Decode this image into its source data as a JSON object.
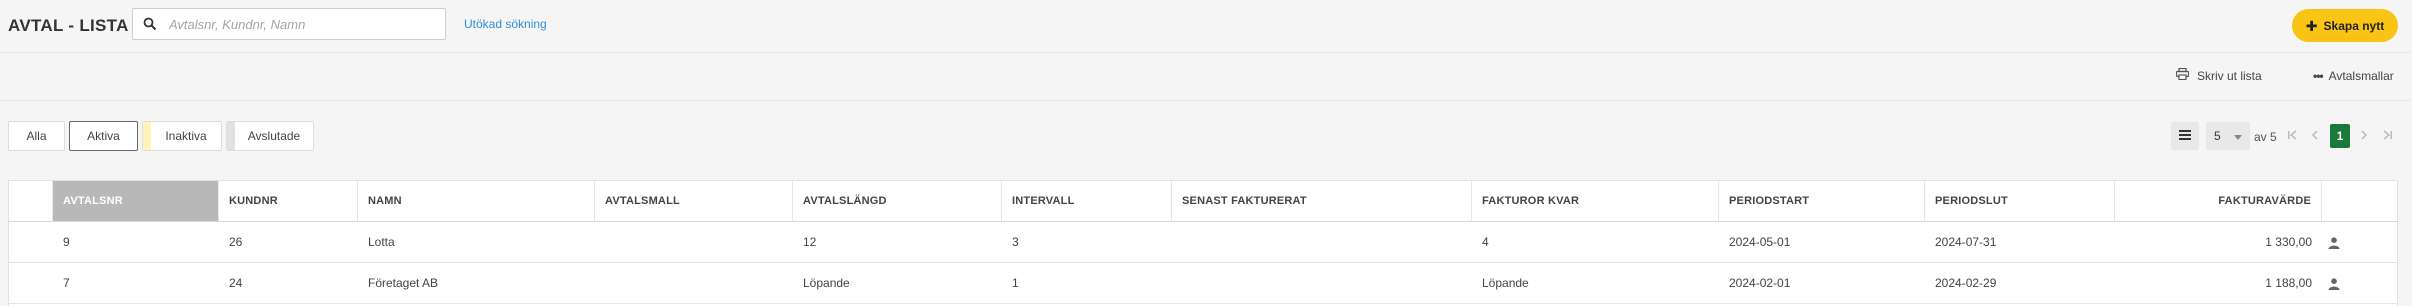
{
  "header": {
    "title": "AVTAL - LISTA",
    "search_placeholder": "Avtalsnr, Kundnr, Namn",
    "advanced_search": "Utökad sökning",
    "create_label": "Skapa nytt"
  },
  "toolbar": {
    "print_label": "Skriv ut lista",
    "templates_label": "Avtalsmallar"
  },
  "filters": [
    {
      "label": "Alla",
      "active": false,
      "color": ""
    },
    {
      "label": "Aktiva",
      "active": true,
      "color": ""
    },
    {
      "label": "Inaktiva",
      "active": false,
      "color": "#fff3b8"
    },
    {
      "label": "Avslutade",
      "active": false,
      "color": "#e2e2e2"
    }
  ],
  "pagination": {
    "page_size": "5",
    "of_label": "av 5",
    "current_page": "1"
  },
  "table": {
    "columns": [
      "AVTALSNR",
      "KUNDNR",
      "NAMN",
      "AVTALSMALL",
      "AVTALSLÄNGD",
      "INTERVALL",
      "SENAST FAKTURERAT",
      "FAKTUROR KVAR",
      "PERIODSTART",
      "PERIODSLUT",
      "FAKTURAVÄRDE"
    ],
    "sorted_column": "AVTALSNR",
    "rows": [
      [
        "9",
        "26",
        "Lotta",
        "",
        "12",
        "3",
        "",
        "4",
        "2024-05-01",
        "2024-07-31",
        "1 330,00"
      ],
      [
        "7",
        "24",
        "Företaget AB",
        "",
        "Löpande",
        "1",
        "",
        "Löpande",
        "2024-02-01",
        "2024-02-29",
        "1 188,00"
      ]
    ]
  },
  "colors": {
    "accent_yellow": "#f9c413",
    "page_active_green": "#1a7a3a",
    "link_blue": "#2f8fd6",
    "sorted_header_gray": "#b8b8b8"
  },
  "icons": [
    "search-icon",
    "plus-icon",
    "printer-icon",
    "more-dots-icon",
    "list-icon",
    "chevron-down-icon",
    "first-page-icon",
    "prev-page-icon",
    "next-page-icon",
    "last-page-icon",
    "user-icon"
  ]
}
